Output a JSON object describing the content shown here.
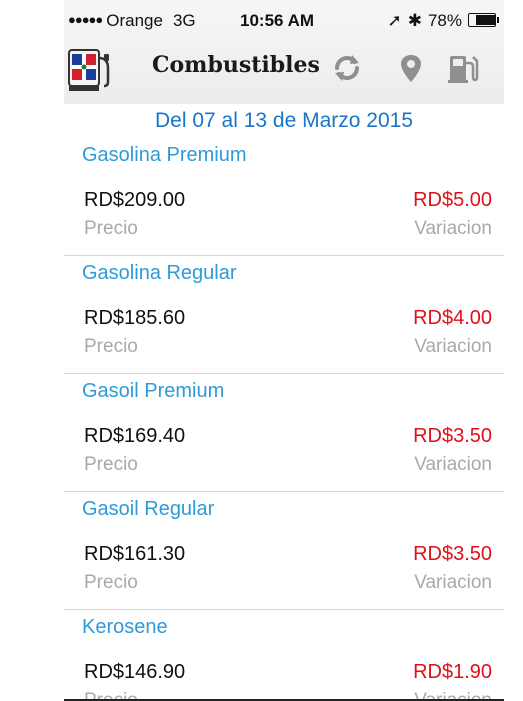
{
  "status_bar": {
    "signal_dots": "●●●●●",
    "carrier": "Orange",
    "network": "3G",
    "time": "10:56 AM",
    "location_icon": "➚",
    "bluetooth_icon": "✱",
    "battery_percent": "78%",
    "battery_level": 0.78
  },
  "nav": {
    "title": "Combustibles",
    "icons": [
      "app-logo-flag-pump",
      "refresh-icon",
      "location-pin-icon",
      "fuel-pump-icon"
    ]
  },
  "date_range": "Del 07 al 13 de Marzo 2015",
  "fuels": [
    {
      "name": "Gasolina Premium",
      "price": "RD$209.00",
      "price_label": "Precio",
      "variation": "RD$5.00",
      "variation_label": "Variacion"
    },
    {
      "name": "Gasolina Regular",
      "price": "RD$185.60",
      "price_label": "Precio",
      "variation": "RD$4.00",
      "variation_label": "Variacion"
    },
    {
      "name": "Gasoil Premium",
      "price": "RD$169.40",
      "price_label": "Precio",
      "variation": "RD$3.50",
      "variation_label": "Variacion"
    },
    {
      "name": "Gasoil Regular",
      "price": "RD$161.30",
      "price_label": "Precio",
      "variation": "RD$3.50",
      "variation_label": "Variacion"
    },
    {
      "name": "Kerosene",
      "price": "RD$146.90",
      "price_label": "Precio",
      "variation": "RD$1.90",
      "variation_label": "Variacion"
    }
  ],
  "colors": {
    "fuel_name": "#2f9ad8",
    "date_range": "#1a75c9",
    "variation": "#e0101a",
    "label_gray": "#a9a9a9"
  }
}
